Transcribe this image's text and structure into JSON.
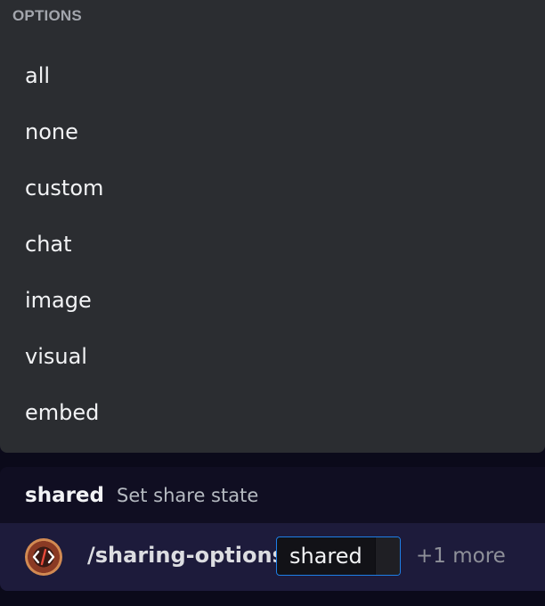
{
  "options": {
    "header": "OPTIONS",
    "items": [
      "all",
      "none",
      "custom",
      "chat",
      "image",
      "visual",
      "embed"
    ]
  },
  "hint": {
    "name": "shared",
    "description": "Set share state"
  },
  "command": {
    "name": "/sharing-options",
    "param_label": "shared",
    "more": "+1 more",
    "avatar_icon": "code-brackets-icon"
  },
  "colors": {
    "panel_bg": "#2b2d31",
    "focus_border": "#1e7ee6",
    "command_row_bg": "#1d1b3b"
  }
}
